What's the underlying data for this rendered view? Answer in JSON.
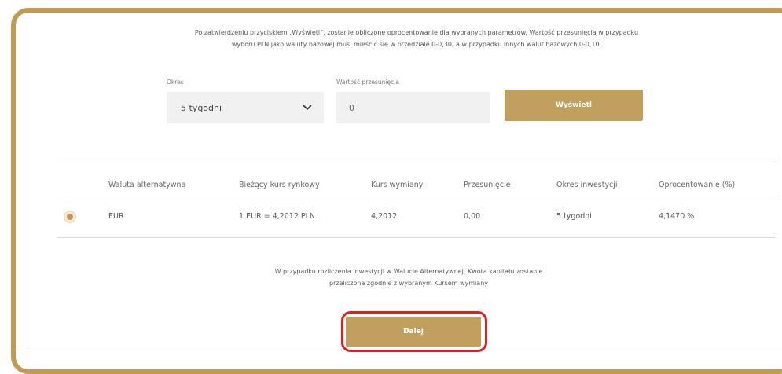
{
  "intro": {
    "line1": "Po zatwierdzeniu przyciskiem „Wyświetl”, zostanie obliczone oprocentowanie dla wybranych parametrów. Wartość przesunięcia w przypadku",
    "line2": "wyboru PLN jako waluty bazowej musi mieścić się w przedziale 0-0,30, a w przypadku innych walut bazowych 0-0,10."
  },
  "form": {
    "period_label": "Okres",
    "period_value": "5 tygodni",
    "shift_label": "Wartość przesunięcia",
    "shift_value": "0",
    "show_button": "Wyświetl"
  },
  "table": {
    "headers": [
      "Waluta alternatywna",
      "Bieżący kurs rynkowy",
      "Kurs wymiany",
      "Przesunięcie",
      "Okres inwestycji",
      "Oprocentowanie (%)"
    ],
    "rows": [
      {
        "selected": true,
        "currency": "EUR",
        "market_rate": "1 EUR = 4,2012 PLN",
        "exchange_rate": "4,2012",
        "shift": "0,00",
        "period": "5 tygodni",
        "interest": "4,1470 %"
      }
    ]
  },
  "note": {
    "line1": "W przypadku rozliczenia Inwestycji w Walucie Alternatywnej, Kwota kapitału zostanie",
    "line2": "przeliczona zgodnie z wybranym Kursem wymiany"
  },
  "footer": {
    "next_button": "Dalej"
  },
  "colors": {
    "gold": "#c19f5f",
    "frame": "#c39a55",
    "highlight": "#e01e1e"
  }
}
